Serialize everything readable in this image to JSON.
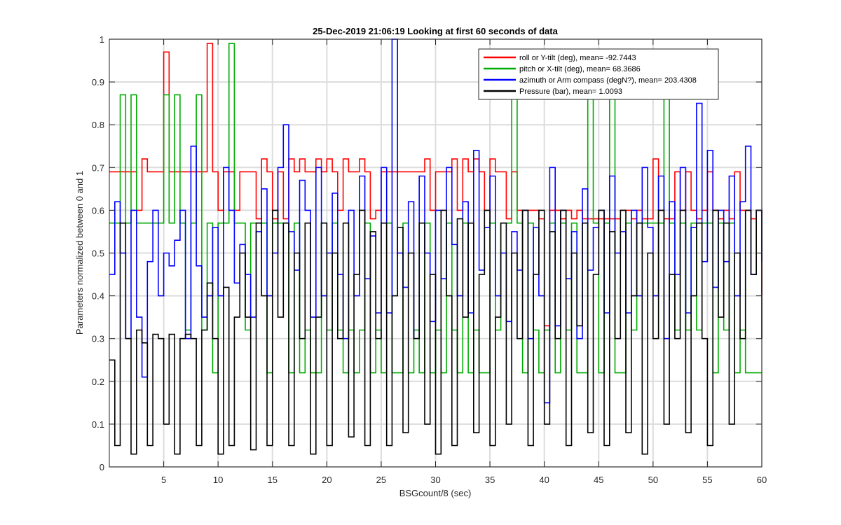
{
  "chart_data": {
    "type": "line",
    "title": "25-Dec-2019 21:06:19 Looking at first 60 seconds of data",
    "xlabel": "BSGcount/8 (sec)",
    "ylabel": "Parameters normalized between 0 and 1",
    "xlim": [
      0,
      60
    ],
    "ylim": [
      0,
      1
    ],
    "xticks": [
      5,
      10,
      15,
      20,
      25,
      30,
      35,
      40,
      45,
      50,
      55,
      60
    ],
    "yticks": [
      0,
      0.1,
      0.2,
      0.3,
      0.4,
      0.5,
      0.6,
      0.7,
      0.8,
      0.9,
      1
    ],
    "grid": true,
    "legend_position": "top-right",
    "x": [
      0,
      0.5,
      1,
      1.5,
      2,
      2.5,
      3,
      3.5,
      4,
      4.5,
      5,
      5.5,
      6,
      6.5,
      7,
      7.5,
      8,
      8.5,
      9,
      9.5,
      10,
      10.5,
      11,
      11.5,
      12,
      12.5,
      13,
      13.5,
      14,
      14.5,
      15,
      15.5,
      16,
      16.5,
      17,
      17.5,
      18,
      18.5,
      19,
      19.5,
      20,
      20.5,
      21,
      21.5,
      22,
      22.5,
      23,
      23.5,
      24,
      24.5,
      25,
      25.5,
      26,
      26.5,
      27,
      27.5,
      28,
      28.5,
      29,
      29.5,
      30,
      30.5,
      31,
      31.5,
      32,
      32.5,
      33,
      33.5,
      34,
      34.5,
      35,
      35.5,
      36,
      36.5,
      37,
      37.5,
      38,
      38.5,
      39,
      39.5,
      40,
      40.5,
      41,
      41.5,
      42,
      42.5,
      43,
      43.5,
      44,
      44.5,
      45,
      45.5,
      46,
      46.5,
      47,
      47.5,
      48,
      48.5,
      49,
      49.5,
      50,
      50.5,
      51,
      51.5,
      52,
      52.5,
      53,
      53.5,
      54,
      54.5,
      55,
      55.5,
      56,
      56.5,
      57,
      57.5,
      58,
      58.5,
      59,
      59.5,
      60
    ],
    "series": [
      {
        "name": "roll or Y-tilt (deg), mean= -92.7443",
        "color": "#ff0000",
        "values": [
          0.69,
          0.69,
          0.69,
          0.69,
          0.69,
          0.6,
          0.72,
          0.69,
          0.69,
          0.69,
          0.97,
          0.69,
          0.69,
          0.69,
          0.69,
          0.69,
          0.69,
          0.69,
          0.99,
          0.69,
          0.6,
          0.69,
          0.69,
          0.6,
          0.69,
          0.69,
          0.69,
          0.58,
          0.72,
          0.69,
          0.58,
          0.69,
          0.58,
          0.72,
          0.69,
          0.72,
          0.69,
          0.69,
          0.72,
          0.69,
          0.72,
          0.69,
          0.6,
          0.72,
          0.69,
          0.69,
          0.72,
          0.69,
          0.58,
          0.6,
          0.69,
          0.69,
          0.69,
          0.69,
          0.69,
          0.69,
          0.69,
          0.69,
          0.72,
          0.6,
          0.69,
          0.69,
          0.69,
          0.72,
          0.6,
          0.72,
          0.69,
          0.72,
          0.69,
          0.6,
          0.72,
          0.69,
          0.69,
          0.58,
          0.69,
          0.6,
          0.6,
          0.6,
          0.6,
          0.58,
          0.33,
          0.6,
          0.6,
          0.58,
          0.6,
          0.58,
          0.6,
          0.58,
          0.58,
          0.58,
          0.58,
          0.58,
          0.58,
          0.58,
          0.6,
          0.6,
          0.58,
          0.6,
          0.58,
          0.58,
          0.72,
          0.6,
          0.58,
          0.58,
          0.69,
          0.6,
          0.69,
          0.6,
          0.58,
          0.6,
          0.69,
          0.6,
          0.58,
          0.6,
          0.58,
          0.69,
          0.6,
          0.6,
          0.58,
          0.6,
          0.4
        ]
      },
      {
        "name": "pitch or X-tilt (deg), mean= 68.3686",
        "color": "#00aa00",
        "values": [
          0.57,
          0.57,
          0.87,
          0.57,
          0.87,
          0.57,
          0.57,
          0.57,
          0.57,
          0.57,
          0.87,
          0.57,
          0.87,
          0.57,
          0.32,
          0.57,
          0.87,
          0.32,
          0.57,
          0.22,
          0.57,
          0.57,
          0.99,
          0.57,
          0.57,
          0.32,
          0.57,
          0.57,
          0.57,
          0.22,
          0.57,
          0.57,
          0.57,
          0.22,
          0.57,
          0.22,
          0.32,
          0.22,
          0.22,
          0.57,
          0.32,
          0.57,
          0.32,
          0.22,
          0.32,
          0.22,
          0.32,
          0.57,
          0.22,
          0.32,
          0.22,
          0.57,
          0.22,
          0.22,
          0.57,
          0.22,
          0.32,
          0.22,
          0.57,
          0.22,
          0.32,
          0.22,
          0.57,
          0.32,
          0.22,
          0.57,
          0.22,
          0.32,
          0.22,
          0.22,
          0.57,
          0.32,
          0.57,
          0.57,
          0.87,
          0.57,
          0.22,
          0.57,
          0.32,
          0.22,
          0.32,
          0.57,
          0.22,
          0.57,
          0.32,
          0.57,
          0.22,
          0.22,
          0.87,
          0.57,
          0.22,
          0.57,
          0.87,
          0.22,
          0.22,
          0.57,
          0.32,
          0.57,
          0.57,
          0.57,
          0.57,
          0.57,
          0.87,
          0.57,
          0.32,
          0.57,
          0.32,
          0.57,
          0.32,
          0.57,
          0.57,
          0.22,
          0.57,
          0.32,
          0.57,
          0.22,
          0.32,
          0.22,
          0.22,
          0.22,
          0.22
        ]
      },
      {
        "name": "azimuth or Arm compass (degN?), mean= 203.4308",
        "color": "#0000ff",
        "values": [
          0.45,
          0.62,
          0.5,
          0.3,
          0.6,
          0.35,
          0.21,
          0.48,
          0.6,
          0.4,
          0.5,
          0.47,
          0.53,
          0.6,
          0.3,
          0.75,
          0.47,
          0.35,
          0.4,
          0.56,
          0.4,
          0.7,
          0.6,
          0.43,
          0.52,
          0.45,
          0.35,
          0.55,
          0.65,
          0.4,
          0.5,
          0.7,
          0.8,
          0.55,
          0.46,
          0.67,
          0.6,
          0.35,
          0.7,
          0.4,
          0.5,
          0.64,
          0.45,
          0.3,
          0.6,
          0.4,
          0.68,
          0.44,
          0.54,
          0.36,
          0.7,
          0.36,
          1.0,
          0.5,
          0.42,
          0.62,
          0.3,
          0.68,
          0.5,
          0.34,
          0.6,
          0.44,
          0.7,
          0.52,
          0.4,
          0.62,
          0.36,
          0.74,
          0.46,
          0.56,
          0.68,
          0.4,
          0.5,
          0.34,
          0.55,
          0.46,
          0.6,
          0.3,
          0.56,
          0.4,
          0.15,
          0.7,
          0.33,
          0.6,
          0.44,
          0.55,
          0.3,
          0.65,
          0.46,
          0.56,
          0.6,
          0.36,
          0.68,
          0.5,
          0.55,
          0.36,
          0.6,
          0.4,
          0.7,
          0.56,
          0.4,
          0.68,
          0.3,
          0.62,
          0.45,
          0.7,
          0.36,
          0.56,
          0.85,
          0.48,
          0.74,
          0.42,
          0.6,
          0.48,
          0.68,
          0.4,
          0.62,
          0.75,
          0.45,
          0.6,
          0.48
        ]
      },
      {
        "name": "Pressure (bar), mean= 1.0093",
        "color": "#000000",
        "values": [
          0.25,
          0.05,
          0.57,
          0.3,
          0.03,
          0.32,
          0.29,
          0.05,
          0.31,
          0.3,
          0.1,
          0.31,
          0.03,
          0.3,
          0.31,
          0.3,
          0.05,
          0.32,
          0.43,
          0.3,
          0.03,
          0.42,
          0.05,
          0.35,
          0.5,
          0.35,
          0.04,
          0.57,
          0.4,
          0.05,
          0.6,
          0.35,
          0.57,
          0.05,
          0.5,
          0.3,
          0.57,
          0.03,
          0.35,
          0.57,
          0.05,
          0.5,
          0.3,
          0.57,
          0.07,
          0.45,
          0.6,
          0.05,
          0.55,
          0.3,
          0.57,
          0.05,
          0.4,
          0.56,
          0.08,
          0.5,
          0.3,
          0.57,
          0.1,
          0.45,
          0.03,
          0.6,
          0.4,
          0.05,
          0.58,
          0.35,
          0.57,
          0.08,
          0.45,
          0.6,
          0.05,
          0.35,
          0.57,
          0.1,
          0.5,
          0.3,
          0.6,
          0.05,
          0.45,
          0.6,
          0.1,
          0.55,
          0.3,
          0.6,
          0.05,
          0.5,
          0.33,
          0.57,
          0.08,
          0.45,
          0.6,
          0.05,
          0.55,
          0.3,
          0.6,
          0.08,
          0.4,
          0.57,
          0.03,
          0.5,
          0.3,
          0.6,
          0.1,
          0.45,
          0.3,
          0.6,
          0.08,
          0.4,
          0.57,
          0.3,
          0.05,
          0.6,
          0.35,
          0.57,
          0.1,
          0.5,
          0.3,
          0.6,
          0.45,
          0.6,
          0.3
        ]
      }
    ]
  }
}
